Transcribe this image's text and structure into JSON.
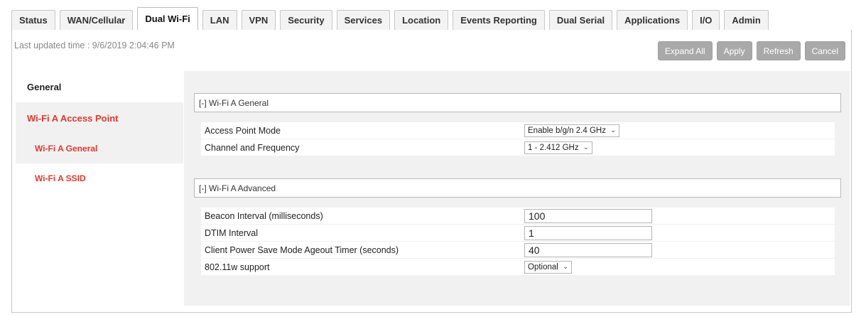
{
  "tabs": [
    {
      "label": "Status",
      "active": false
    },
    {
      "label": "WAN/Cellular",
      "active": false
    },
    {
      "label": "Dual Wi-Fi",
      "active": true
    },
    {
      "label": "LAN",
      "active": false
    },
    {
      "label": "VPN",
      "active": false
    },
    {
      "label": "Security",
      "active": false
    },
    {
      "label": "Services",
      "active": false
    },
    {
      "label": "Location",
      "active": false
    },
    {
      "label": "Events Reporting",
      "active": false
    },
    {
      "label": "Dual Serial",
      "active": false
    },
    {
      "label": "Applications",
      "active": false
    },
    {
      "label": "I/O",
      "active": false
    },
    {
      "label": "Admin",
      "active": false
    }
  ],
  "last_updated": "Last updated time : 9/6/2019 2:04:46 PM",
  "toolbar": {
    "expand_all": "Expand All",
    "apply": "Apply",
    "refresh": "Refresh",
    "cancel": "Cancel"
  },
  "nav": {
    "general": "General",
    "section": "Wi-Fi A Access Point",
    "items": [
      "Wi-Fi A General",
      "Wi-Fi A SSID"
    ]
  },
  "general_section": {
    "header": "[-] Wi-Fi A General",
    "ap_mode_label": "Access Point Mode",
    "ap_mode_value": "Enable b/g/n 2.4 GHz",
    "channel_label": "Channel and Frequency",
    "channel_value": "1 - 2.412 GHz"
  },
  "advanced_section": {
    "header": "[-] Wi-Fi A Advanced",
    "beacon_label": "Beacon Interval (milliseconds)",
    "beacon_value": "100",
    "dtim_label": "DTIM Interval",
    "dtim_value": "1",
    "ageout_label": "Client Power Save Mode Ageout Timer (seconds)",
    "ageout_value": "40",
    "pmf_label": "802.11w support",
    "pmf_value": "Optional"
  },
  "colors": {
    "accent_red": "#e03a2f",
    "button_gray": "#a9a9a9",
    "panel_bg": "#f1f1f1"
  }
}
